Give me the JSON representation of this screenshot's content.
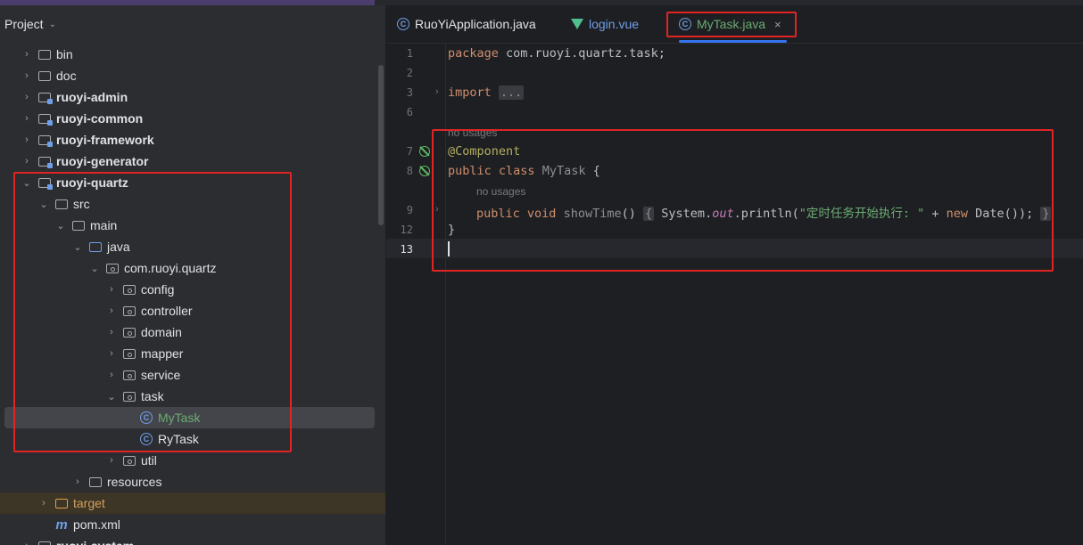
{
  "project": {
    "title": "Project",
    "tree": [
      {
        "label": "bin",
        "type": "folder",
        "depth": 0,
        "arrow": "›",
        "bold": false
      },
      {
        "label": "doc",
        "type": "folder",
        "depth": 0,
        "arrow": "›",
        "bold": false
      },
      {
        "label": "ruoyi-admin",
        "type": "module",
        "depth": 0,
        "arrow": "›",
        "bold": true
      },
      {
        "label": "ruoyi-common",
        "type": "module",
        "depth": 0,
        "arrow": "›",
        "bold": true
      },
      {
        "label": "ruoyi-framework",
        "type": "module",
        "depth": 0,
        "arrow": "›",
        "bold": true
      },
      {
        "label": "ruoyi-generator",
        "type": "module",
        "depth": 0,
        "arrow": "›",
        "bold": true
      },
      {
        "label": "ruoyi-quartz",
        "type": "module",
        "depth": 0,
        "arrow": "⌄",
        "bold": true
      },
      {
        "label": "src",
        "type": "folder",
        "depth": 1,
        "arrow": "⌄",
        "bold": false
      },
      {
        "label": "main",
        "type": "folder",
        "depth": 2,
        "arrow": "⌄",
        "bold": false
      },
      {
        "label": "java",
        "type": "srcfolder",
        "depth": 3,
        "arrow": "⌄",
        "bold": false
      },
      {
        "label": "com.ruoyi.quartz",
        "type": "package",
        "depth": 4,
        "arrow": "⌄",
        "bold": false
      },
      {
        "label": "config",
        "type": "package",
        "depth": 5,
        "arrow": "›",
        "bold": false
      },
      {
        "label": "controller",
        "type": "package",
        "depth": 5,
        "arrow": "›",
        "bold": false
      },
      {
        "label": "domain",
        "type": "package",
        "depth": 5,
        "arrow": "›",
        "bold": false
      },
      {
        "label": "mapper",
        "type": "package",
        "depth": 5,
        "arrow": "›",
        "bold": false
      },
      {
        "label": "service",
        "type": "package",
        "depth": 5,
        "arrow": "›",
        "bold": false
      },
      {
        "label": "task",
        "type": "package",
        "depth": 5,
        "arrow": "⌄",
        "bold": false
      },
      {
        "label": "MyTask",
        "type": "class",
        "depth": 6,
        "arrow": "",
        "bold": false,
        "selected": true,
        "green": true
      },
      {
        "label": "RyTask",
        "type": "class",
        "depth": 6,
        "arrow": "",
        "bold": false
      },
      {
        "label": "util",
        "type": "package",
        "depth": 5,
        "arrow": "›",
        "bold": false
      },
      {
        "label": "resources",
        "type": "folder",
        "depth": 3,
        "arrow": "›",
        "bold": false
      },
      {
        "label": "target",
        "type": "target",
        "depth": 1,
        "arrow": "›",
        "bold": false,
        "orange": true
      },
      {
        "label": "pom.xml",
        "type": "maven",
        "depth": 1,
        "arrow": "",
        "bold": false
      },
      {
        "label": "ruoyi-system",
        "type": "module",
        "depth": 0,
        "arrow": "›",
        "bold": true
      }
    ]
  },
  "tabs": [
    {
      "label": "RuoYiApplication.java",
      "icon": "java-class-icon",
      "active": false
    },
    {
      "label": "login.vue",
      "icon": "vue-icon",
      "active": false
    },
    {
      "label": "MyTask.java",
      "icon": "java-class-icon",
      "active": true,
      "close": "×"
    }
  ],
  "editor": {
    "line_numbers": [
      "1",
      "2",
      "3",
      "6",
      "7",
      "8",
      "9",
      "12",
      "13"
    ],
    "hint_usages_1": "no usages",
    "hint_usages_2": "no usages",
    "line1": {
      "kw": "package",
      "rest": " com.ruoyi.quartz.task;"
    },
    "line3": {
      "kw": "import",
      "fold": "..."
    },
    "line7": "@Component",
    "line8": {
      "kw1": "public",
      "kw2": "class",
      "name": "MyTask",
      "brace": " {"
    },
    "line9": {
      "kw1": "public",
      "kw2": "void",
      "name": "showTime",
      "paren": "()",
      "ob": "{",
      "sys": "System.",
      "out": "out",
      "println": ".println(",
      "str": "\"定时任务开始执行: \"",
      "plus": " + ",
      "kwnew": "new",
      "date": " Date());",
      "cb": "}"
    },
    "line12": "}"
  }
}
